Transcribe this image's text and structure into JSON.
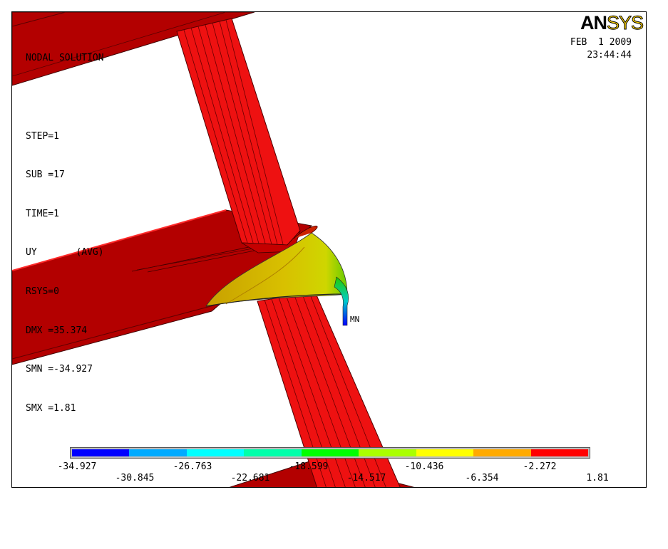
{
  "header": {
    "logo_an": "AN",
    "logo_sys": "SYS",
    "date": "FEB  1 2009",
    "time": "23:44:44"
  },
  "info": {
    "lines": [
      "NODAL SOLUTION",
      "",
      "STEP=1",
      "SUB =17",
      "TIME=1",
      "UY       (AVG)",
      "RSYS=0",
      "DMX =35.374",
      "SMN =-34.927",
      "SMX =1.81"
    ]
  },
  "markers": {
    "min_label": "MN"
  },
  "legend": {
    "colors": [
      "#0000ff",
      "#00aaff",
      "#00ffff",
      "#00ffaa",
      "#00ff00",
      "#aaff00",
      "#ffff00",
      "#ffaa00",
      "#ff0000"
    ],
    "top_labels": [
      "-34.927",
      "-26.763",
      "-18.599",
      "-10.436",
      "-2.272"
    ],
    "bottom_labels": [
      "-30.845",
      "-22.681",
      "-14.517",
      "-6.354",
      "1.81"
    ]
  }
}
